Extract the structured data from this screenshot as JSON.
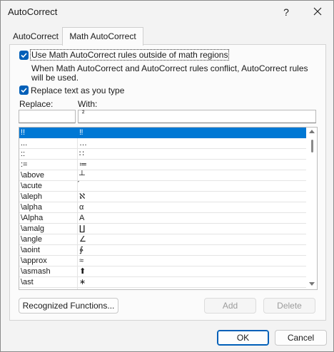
{
  "window": {
    "title": "AutoCorrect",
    "help_label": "?"
  },
  "tabs": [
    {
      "label": "AutoCorrect"
    },
    {
      "label": "Math AutoCorrect"
    }
  ],
  "options": {
    "use_outside": {
      "label": "Use Math AutoCorrect rules outside of math regions",
      "checked": true
    },
    "conflict_note": "When Math AutoCorrect and AutoCorrect rules conflict, AutoCorrect rules will be used.",
    "replace_as_type": {
      "label": "Replace text as you type",
      "checked": true
    }
  },
  "fields": {
    "replace_label": "Replace:",
    "with_label": "With:",
    "replace_value": "",
    "with_value": "²"
  },
  "entries": [
    {
      "replace": "!!",
      "with": "‼"
    },
    {
      "replace": "...",
      "with": "…"
    },
    {
      "replace": "::",
      "with": "∷"
    },
    {
      "replace": ":=",
      "with": "≔"
    },
    {
      "replace": "\\above",
      "with": "┴"
    },
    {
      "replace": "\\acute",
      "with": "́"
    },
    {
      "replace": "\\aleph",
      "with": "ℵ"
    },
    {
      "replace": "\\alpha",
      "with": "α"
    },
    {
      "replace": "\\Alpha",
      "with": "Α"
    },
    {
      "replace": "\\amalg",
      "with": "∐"
    },
    {
      "replace": "\\angle",
      "with": "∠"
    },
    {
      "replace": "\\aoint",
      "with": "∳"
    },
    {
      "replace": "\\approx",
      "with": "≈"
    },
    {
      "replace": "\\asmash",
      "with": "⬆"
    },
    {
      "replace": "\\ast",
      "with": "∗"
    }
  ],
  "buttons": {
    "recognized": "Recognized Functions...",
    "add": "Add",
    "delete": "Delete",
    "ok": "OK",
    "cancel": "Cancel"
  }
}
